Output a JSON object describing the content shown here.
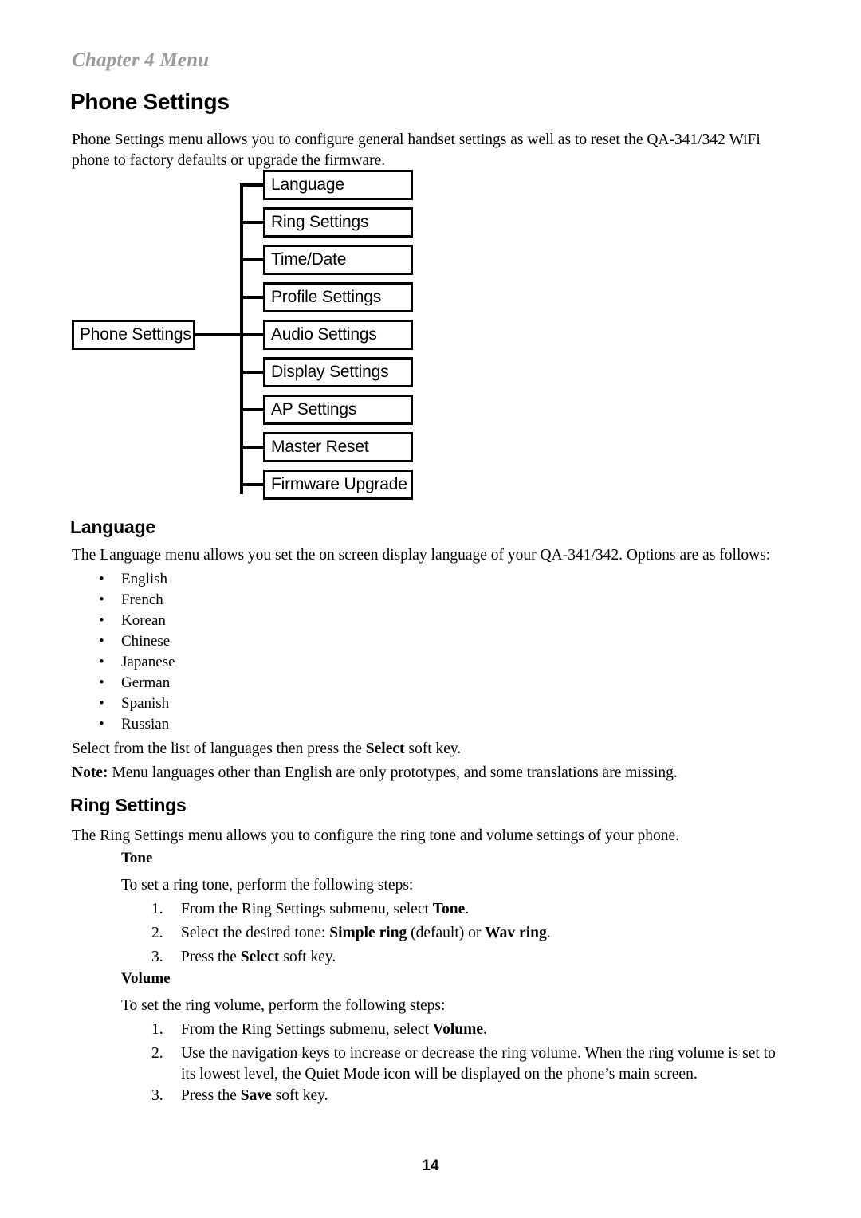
{
  "header": {
    "running_head": "Chapter 4 Menu"
  },
  "title": "Phone Settings",
  "intro_paragraph": "Phone Settings menu allows you to configure general handset settings as well as to reset the QA-341/342 WiFi phone to factory defaults or upgrade the firmware.",
  "diagram": {
    "root_label": "Phone Settings",
    "items": [
      {
        "label": "Language"
      },
      {
        "label": "Ring Settings"
      },
      {
        "label": "Time/Date"
      },
      {
        "label": "Profile Settings"
      },
      {
        "label": "Audio Settings"
      },
      {
        "label": "Display Settings"
      },
      {
        "label": "AP Settings"
      },
      {
        "label": "Master Reset"
      },
      {
        "label": "Firmware Upgrade"
      }
    ]
  },
  "language_section": {
    "heading": "Language",
    "intro": "The Language menu allows you set the on screen display language of your QA-341/342. Options are as follows:",
    "options": [
      "English",
      "French",
      "Korean",
      "Chinese",
      "Japanese",
      "German",
      "Spanish",
      "Russian"
    ],
    "bullet_glyph": "•",
    "select_text_before": "Select from the list of languages then press the ",
    "select_bold": "Select",
    "select_text_after": " soft key.",
    "note_label": "Note:",
    "note_text": " Menu languages other than English are only prototypes, and some translations are missing."
  },
  "ring_section": {
    "heading": "Ring Settings",
    "intro": "The Ring Settings menu allows you to configure the ring tone and volume settings of your phone.",
    "tone": {
      "heading": "Tone",
      "intro": "To set a ring tone, perform the following steps:",
      "steps": [
        {
          "number": "1.",
          "before": "From the Ring Settings submenu, select ",
          "bold": "Tone",
          "after": "."
        },
        {
          "number": "2.",
          "before": "Select the desired tone: ",
          "bold": "Simple ring",
          "mid": " (default) or ",
          "bold2": "Wav ring",
          "after": "."
        },
        {
          "number": "3.",
          "before": "Press the ",
          "bold": "Select",
          "after": " soft key."
        }
      ]
    },
    "volume": {
      "heading": "Volume",
      "intro": "To set the ring volume, perform the following steps:",
      "steps": [
        {
          "number": "1.",
          "before": "From the Ring Settings submenu, select ",
          "bold": "Volume",
          "after": "."
        },
        {
          "number": "2.",
          "before": "Use the navigation keys to increase or decrease the ring volume. When the ring volume is set to its lowest level, the Quiet Mode icon will be displayed on the phone’s main screen.",
          "bold": "",
          "after": ""
        },
        {
          "number": "3.",
          "before": "Press the ",
          "bold": "Save",
          "after": " soft key."
        }
      ]
    }
  },
  "footer": {
    "page_number": "14"
  }
}
